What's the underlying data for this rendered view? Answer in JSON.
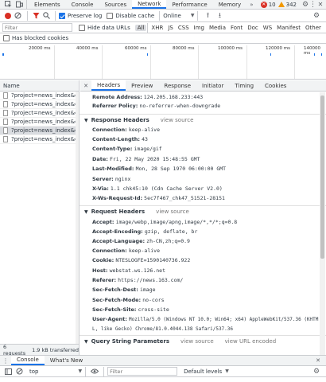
{
  "main_tabs": [
    {
      "label": "Elements"
    },
    {
      "label": "Console"
    },
    {
      "label": "Sources"
    },
    {
      "label": "Network"
    },
    {
      "label": "Performance"
    },
    {
      "label": "Memory"
    }
  ],
  "more_tabs": "»",
  "error_count": "10",
  "warning_count": "342",
  "toolbar": {
    "preserve_log": "Preserve log",
    "disable_cache": "Disable cache",
    "throttle": "Online"
  },
  "filter": {
    "placeholder": "Filter",
    "hide_data_urls": "Hide data URLs",
    "types": [
      "All",
      "XHR",
      "JS",
      "CSS",
      "Img",
      "Media",
      "Font",
      "Doc",
      "WS",
      "Manifest",
      "Other"
    ],
    "blocked_cookies": "Has blocked cookies"
  },
  "timeline_ticks": [
    "20000 ms",
    "40000 ms",
    "60000 ms",
    "80000 ms",
    "100000 ms",
    "120000 ms",
    "140000 ms"
  ],
  "request_list": {
    "header": "Name",
    "items": [
      "?project=news_index&eve...",
      "?project=news_index&eve...",
      "?project=news_index&eve...",
      "?project=news_index&eve...",
      "?project=news_index&eve...",
      "?project=news_index&eve..."
    ],
    "summary_requests": "6 requests",
    "summary_transferred": "1.9 kB transferred"
  },
  "detail_tabs": [
    "Headers",
    "Preview",
    "Response",
    "Initiator",
    "Timing",
    "Cookies"
  ],
  "general": [
    {
      "k": "Remote Address:",
      "v": "124.205.168.233:443"
    },
    {
      "k": "Referrer Policy:",
      "v": "no-referrer-when-downgrade"
    }
  ],
  "response_headers": {
    "title": "Response Headers",
    "src": "view source",
    "items": [
      {
        "k": "Connection:",
        "v": "keep-alive"
      },
      {
        "k": "Content-Length:",
        "v": "43"
      },
      {
        "k": "Content-Type:",
        "v": "image/gif"
      },
      {
        "k": "Date:",
        "v": "Fri, 22 May 2020 15:48:55 GMT"
      },
      {
        "k": "Last-Modified:",
        "v": "Mon, 28 Sep 1970 06:00:00 GMT"
      },
      {
        "k": "Server:",
        "v": "nginx"
      },
      {
        "k": "X-Via:",
        "v": "1.1 chk45:10 (Cdn Cache Server V2.0)"
      },
      {
        "k": "X-Ws-Request-Id:",
        "v": "5ec7f467_chk47_51521-28151"
      }
    ]
  },
  "request_headers": {
    "title": "Request Headers",
    "src": "view source",
    "items": [
      {
        "k": "Accept:",
        "v": "image/webp,image/apng,image/*,*/*;q=0.8"
      },
      {
        "k": "Accept-Encoding:",
        "v": "gzip, deflate, br"
      },
      {
        "k": "Accept-Language:",
        "v": "zh-CN,zh;q=0.9"
      },
      {
        "k": "Connection:",
        "v": "keep-alive"
      },
      {
        "k": "Cookie:",
        "v": "NTESLOGFE=1590140736.922"
      },
      {
        "k": "Host:",
        "v": "webstat.ws.126.net"
      },
      {
        "k": "Referer:",
        "v": "https://news.163.com/"
      },
      {
        "k": "Sec-Fetch-Dest:",
        "v": "image"
      },
      {
        "k": "Sec-Fetch-Mode:",
        "v": "no-cors"
      },
      {
        "k": "Sec-Fetch-Site:",
        "v": "cross-site"
      },
      {
        "k": "User-Agent:",
        "v": "Mozilla/5.0 (Windows NT 10.0; Win64; x64) AppleWebKit/537.36 (KHTM"
      },
      {
        "k": "",
        "v": "L, like Gecko) Chrome/81.0.4044.138 Safari/537.36"
      }
    ]
  },
  "query_params": {
    "title": "Query String Parameters",
    "src": "view source",
    "url": "view URL encoded"
  },
  "drawer": {
    "tabs": [
      "Console",
      "What's New"
    ],
    "context": "top",
    "filter_placeholder": "Filter",
    "levels": "Default levels"
  },
  "colors": {
    "accent": "#1a73e8",
    "error": "#d93025",
    "warning": "#f29900"
  }
}
